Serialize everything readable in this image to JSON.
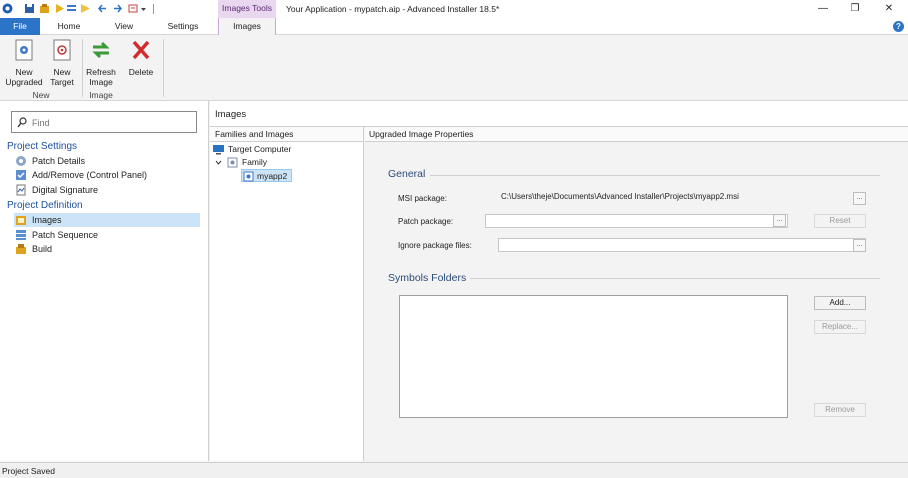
{
  "window": {
    "title": "Your Application - mypatch.aip - Advanced Installer 18.5*",
    "context_tab_group": "Images Tools",
    "controls": {
      "minimize": "—",
      "maximize": "❐",
      "close": "✕"
    }
  },
  "ribbon": {
    "tabs": [
      "File",
      "Home",
      "View",
      "Settings",
      "Images"
    ],
    "active_tab": "Images",
    "help": "?",
    "groups": [
      {
        "label": "New",
        "buttons": [
          {
            "label_line1": "New",
            "label_line2": "Upgraded",
            "icon": "new-upgraded-icon"
          },
          {
            "label_line1": "New",
            "label_line2": "Target",
            "icon": "new-target-icon"
          }
        ]
      },
      {
        "label": "Image",
        "buttons": [
          {
            "label_line1": "Refresh",
            "label_line2": "Image",
            "icon": "refresh-icon"
          },
          {
            "label_line1": "Delete",
            "label_line2": "",
            "icon": "delete-icon"
          }
        ]
      }
    ]
  },
  "sidebar": {
    "search_placeholder": "Find",
    "sections": [
      {
        "title": "Project Settings",
        "items": [
          {
            "label": "Patch Details",
            "icon": "patch-details-icon"
          },
          {
            "label": "Add/Remove (Control Panel)",
            "icon": "add-remove-icon"
          },
          {
            "label": "Digital Signature",
            "icon": "signature-icon"
          }
        ]
      },
      {
        "title": "Project Definition",
        "items": [
          {
            "label": "Images",
            "icon": "images-icon",
            "selected": true
          },
          {
            "label": "Patch Sequence",
            "icon": "sequence-icon"
          },
          {
            "label": "Build",
            "icon": "build-icon"
          }
        ]
      }
    ]
  },
  "main": {
    "title": "Images",
    "families_header": "Families and Images",
    "tree": {
      "root": "Target Computer",
      "family": "Family",
      "image": "myapp2"
    },
    "properties_header": "Upgraded Image Properties",
    "general": {
      "title": "General",
      "msi_label": "MSI package:",
      "msi_value": "C:\\Users\\theje\\Documents\\Advanced Installer\\Projects\\myapp2.msi",
      "patch_label": "Patch package:",
      "patch_value": "",
      "ignore_label": "Ignore package files:",
      "ignore_value": "",
      "browse": "...",
      "reset": "Reset"
    },
    "symbols": {
      "title": "Symbols Folders",
      "add": "Add...",
      "replace": "Replace...",
      "remove": "Remove"
    }
  },
  "status": {
    "text": "Project Saved"
  }
}
